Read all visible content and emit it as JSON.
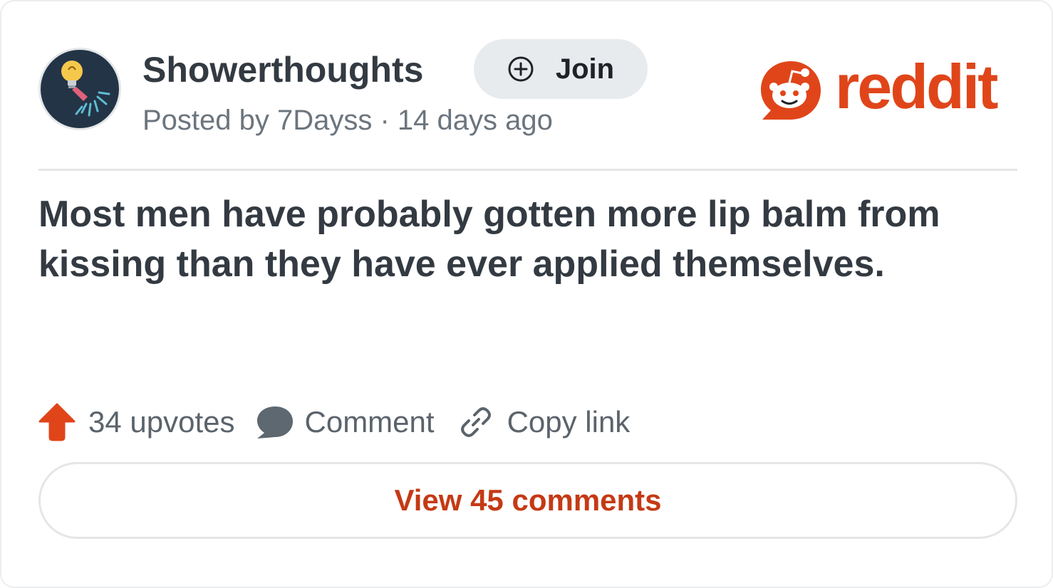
{
  "subreddit": {
    "name": "Showerthoughts",
    "avatar_icon": "lightbulb-shower-head-icon",
    "join_label": "Join",
    "join_icon": "plus-circle-icon"
  },
  "post": {
    "meta": "Posted by 7Dayss · 14 days ago",
    "title": "Most men have probably gotten more lip balm from kissing than they have ever applied themselves."
  },
  "brand": {
    "wordmark": "reddit",
    "icon": "reddit-snoo-icon",
    "color": "#e0451a"
  },
  "actions": {
    "upvotes_label": "34 upvotes",
    "upvote_icon": "upvote-arrow-icon",
    "comment_label": "Comment",
    "comment_icon": "speech-bubble-icon",
    "copy_link_label": "Copy link",
    "copy_link_icon": "link-icon"
  },
  "footer": {
    "view_comments_label": "View 45 comments"
  },
  "colors": {
    "text_primary": "#333a42",
    "text_secondary": "#6c757e",
    "accent": "#e0451a",
    "button_bg": "#e8ebee",
    "divider": "#e4e6e8"
  }
}
